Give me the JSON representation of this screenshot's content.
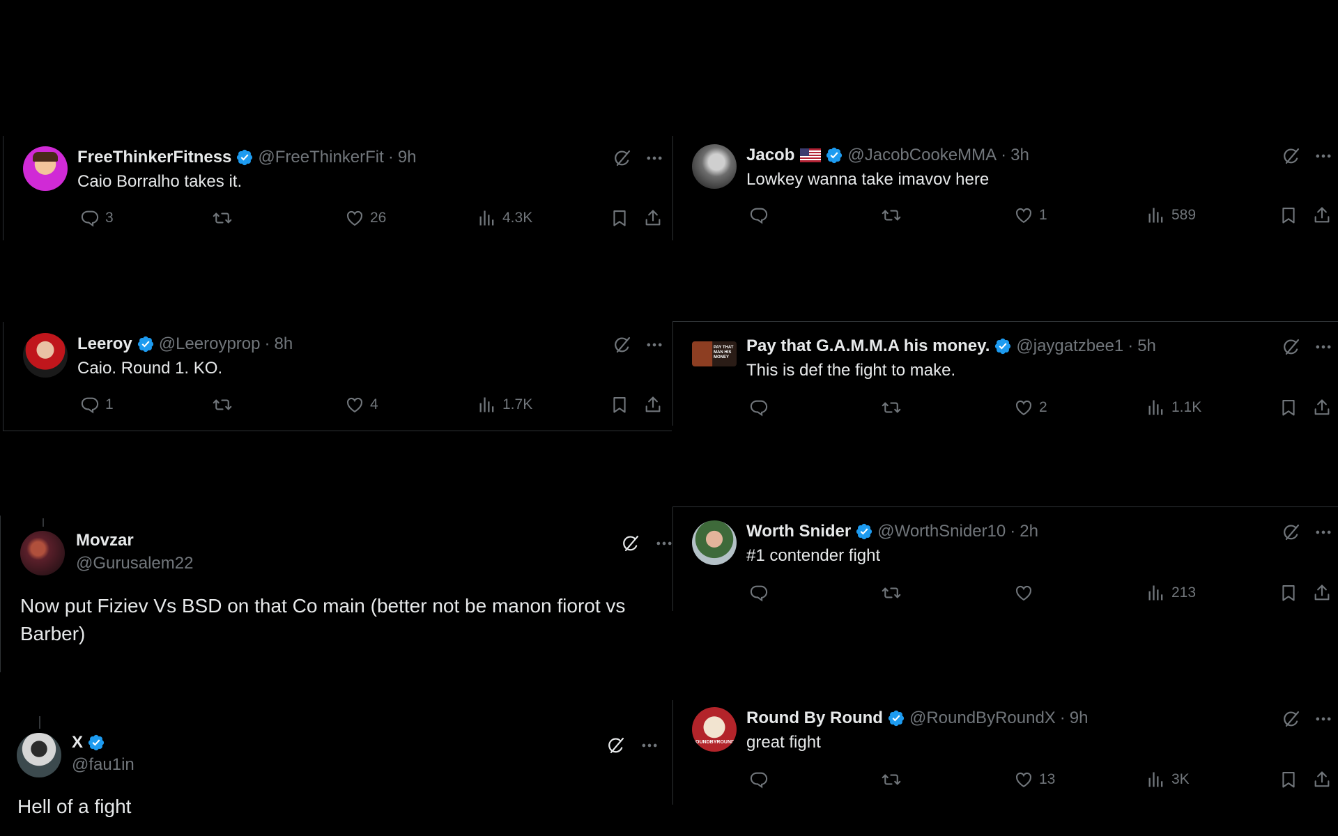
{
  "posts": [
    {
      "name": "FreeThinkerFitness",
      "handle": "@FreeThinkerFit",
      "time": "9h",
      "verified": true,
      "text": "Caio Borralho takes it.",
      "replies": "3",
      "reposts": "",
      "likes": "26",
      "views": "4.3K"
    },
    {
      "name": "Jacob",
      "handle": "@JacobCookeMMA",
      "time": "3h",
      "verified": true,
      "flag": "US",
      "text": "Lowkey wanna take imavov here",
      "replies": "",
      "reposts": "",
      "likes": "1",
      "views": "589"
    },
    {
      "name": "Leeroy",
      "handle": "@Leeroyprop",
      "time": "8h",
      "verified": true,
      "text": "Caio. Round 1. KO.",
      "replies": "1",
      "reposts": "",
      "likes": "4",
      "views": "1.7K"
    },
    {
      "name": "Pay that G.A.M.M.A his money.",
      "handle": "@jaygatzbee1",
      "time": "5h",
      "verified": true,
      "avatar_text": "PAY THAT MAN HIS MONEY",
      "text": "This is def the fight to make.",
      "replies": "",
      "reposts": "",
      "likes": "2",
      "views": "1.1K"
    },
    {
      "name": "Movzar",
      "handle": "@Gurusalem22",
      "verified": false,
      "text": "Now put Fiziev Vs BSD on that Co main (better not be manon fiorot vs Barber)"
    },
    {
      "name": "Worth Snider",
      "handle": "@WorthSnider10",
      "time": "2h",
      "verified": true,
      "text": "#1 contender fight",
      "replies": "",
      "reposts": "",
      "likes": "",
      "views": "213"
    },
    {
      "name": "X",
      "handle": "@fau1in",
      "verified": true,
      "text": "Hell of a fight"
    },
    {
      "name": "Round By Round",
      "handle": "@RoundByRoundX",
      "time": "9h",
      "verified": true,
      "avatar_text": "ROUNDBYROUNDX",
      "text": "great fight",
      "replies": "",
      "reposts": "",
      "likes": "13",
      "views": "3K"
    }
  ],
  "separator": "·",
  "icons": {
    "reply": "reply-icon",
    "repost": "repost-icon",
    "like": "heart-icon",
    "views": "views-icon",
    "bookmark": "bookmark-icon",
    "share": "share-icon",
    "grok": "grok-icon",
    "more": "more-icon",
    "verified": "verified-badge-icon"
  },
  "colors": {
    "background": "#000000",
    "text": "#e7e9ea",
    "muted": "#71767b",
    "verified": "#1d9bf0"
  }
}
